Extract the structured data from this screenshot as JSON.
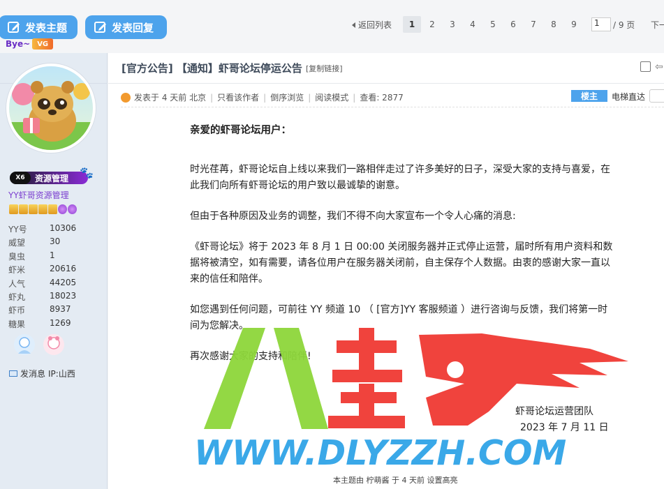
{
  "toolbar": {
    "new_topic_label": "发表主题",
    "reply_label": "发表回复",
    "back_label": "返回列表",
    "pages": [
      "1",
      "2",
      "3",
      "4",
      "5",
      "6",
      "7",
      "8",
      "9"
    ],
    "current_page": "1",
    "page_input_value": "1",
    "page_total": "/ 9 页",
    "next_label": "下一页"
  },
  "user": {
    "name": "Bye~",
    "vg_badge": "VG",
    "group_badge_prefix": "X6",
    "group_badge": "资源管理",
    "group_name": "YY虾哥资源管理",
    "stats": [
      {
        "k": "YY号",
        "v": "10306"
      },
      {
        "k": "威望",
        "v": "30"
      },
      {
        "k": "臭虫",
        "v": "1"
      },
      {
        "k": "虾米",
        "v": "20616"
      },
      {
        "k": "人气",
        "v": "44205"
      },
      {
        "k": "虾丸",
        "v": "18023"
      },
      {
        "k": "虾币",
        "v": "8937"
      },
      {
        "k": "糖果",
        "v": "1269"
      }
    ],
    "send_msg_label": "发消息",
    "ip_label": "IP:山西"
  },
  "post": {
    "title": "[官方公告] 【通知】虾哥论坛停运公告",
    "copy_link_label": "[复制链接]",
    "meta": {
      "posted": "发表于 4 天前 北京",
      "only_author": "只看该作者",
      "reverse": "倒序浏览",
      "read_mode": "阅读模式",
      "views": "查看: 2877"
    },
    "owner_tag": "楼主",
    "lift_label": "电梯直达",
    "greeting": "亲爱的虾哥论坛用户：",
    "paragraphs": [
      "时光荏苒，虾哥论坛自上线以来我们一路相伴走过了许多美好的日子，深受大家的支持与喜爱，在此我们向所有虾哥论坛的用户致以最诚挚的谢意。",
      "但由于各种原因及业务的调整，我们不得不向大家宣布一个令人心痛的消息:",
      "《虾哥论坛》将于 2023 年 8 月 1 日 00:00 关闭服务器并正式停止运营，届时所有用户资料和数据将被清空，如有需要，请各位用户在服务器关闭前，自主保存个人数据。由衷的感谢大家一直以来的信任和陪伴。",
      "如您遇到任何问题，可前往 YY 频道 10 （ [官方]YY 客服频道 ）进行咨询与反馈，我们将第一时间为您解决。",
      "再次感谢大家的支持和陪伴!"
    ],
    "sign_team": "虾哥论坛运营团队",
    "sign_date": "2023 年 7 月 11 日",
    "footer_note": "本主题由 柠萌酱 于 4 天前 设置高亮"
  },
  "watermark": {
    "text": "WWW.DLYZZH.COM"
  },
  "colors": {
    "accent_blue": "#4da3ec",
    "side_bg": "#e4ebf3",
    "purple": "#7b3fd0",
    "watermark_green": "#8dd63a",
    "watermark_red": "#f0433d",
    "watermark_blue": "#3aa8e8"
  }
}
